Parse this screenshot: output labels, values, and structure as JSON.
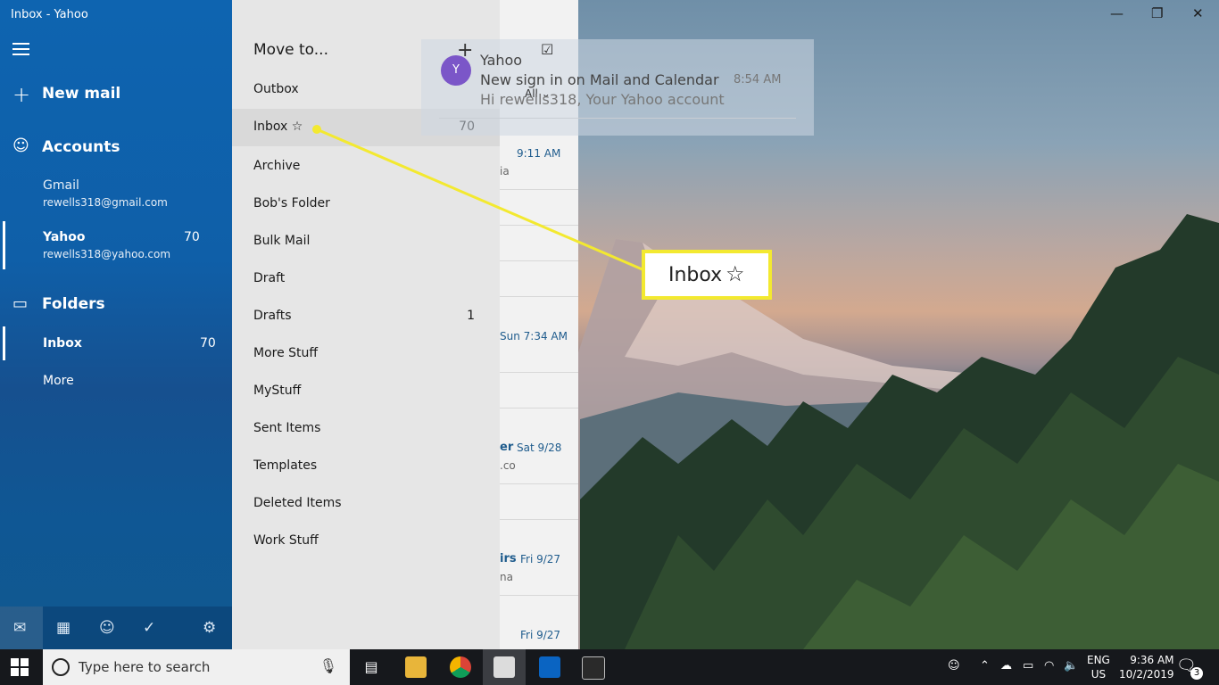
{
  "window": {
    "title": "Inbox - Yahoo",
    "minimize_icon": "minimize-icon",
    "maximize_icon": "restore-icon",
    "close_icon": "close-icon"
  },
  "sidebar": {
    "new_mail": "New mail",
    "accounts_label": "Accounts",
    "accounts": [
      {
        "name": "Gmail",
        "email": "rewells318@gmail.com",
        "count": ""
      },
      {
        "name": "Yahoo",
        "email": "rewells318@yahoo.com",
        "count": "70"
      }
    ],
    "folders_label": "Folders",
    "folders": [
      {
        "name": "Inbox",
        "count": "70"
      },
      {
        "name": "More",
        "count": ""
      }
    ],
    "bottom_icons": [
      "mail-icon",
      "calendar-icon",
      "people-icon",
      "todo-icon",
      "settings-icon"
    ],
    "colors": {
      "accent": "#0e64b0"
    }
  },
  "move_to": {
    "title": "Move to...",
    "items": [
      {
        "label": "Outbox",
        "count": ""
      },
      {
        "label": "Inbox ☆",
        "count": "70"
      },
      {
        "label": "Archive",
        "count": ""
      },
      {
        "label": "Bob's Folder",
        "count": ""
      },
      {
        "label": "Bulk Mail",
        "count": ""
      },
      {
        "label": "Draft",
        "count": ""
      },
      {
        "label": "Drafts",
        "count": "1"
      },
      {
        "label": "More Stuff",
        "count": ""
      },
      {
        "label": "MyStuff",
        "count": ""
      },
      {
        "label": "Sent Items",
        "count": ""
      },
      {
        "label": "Templates",
        "count": ""
      },
      {
        "label": "Deleted Items",
        "count": ""
      },
      {
        "label": "Work Stuff",
        "count": ""
      }
    ]
  },
  "message_list": {
    "filter": "All",
    "times": [
      "9:11 AM",
      "Sun 7:34 AM",
      "Sat 9/28",
      "Fri 9/27",
      "Fri 9/27"
    ],
    "fragments": [
      "ia",
      "er",
      ".co",
      "irs",
      "na"
    ]
  },
  "toast": {
    "avatar_letter": "Y",
    "sender": "Yahoo",
    "subject": "New sign in on Mail and Calendar",
    "preview": "Hi rewells318, Your Yahoo account rew",
    "time": "8:54 AM"
  },
  "callout": {
    "label": "Inbox",
    "star": "☆",
    "border_color": "#f3e930"
  },
  "taskbar": {
    "search_placeholder": "Type here to search",
    "apps": [
      "task-view-icon",
      "file-explorer-icon",
      "chrome-icon",
      "mail-app-icon",
      "outlook-icon",
      "photos-icon"
    ],
    "language_line1": "ENG",
    "language_line2": "US",
    "time": "9:36 AM",
    "date": "10/2/2019",
    "notification_count": "3"
  }
}
